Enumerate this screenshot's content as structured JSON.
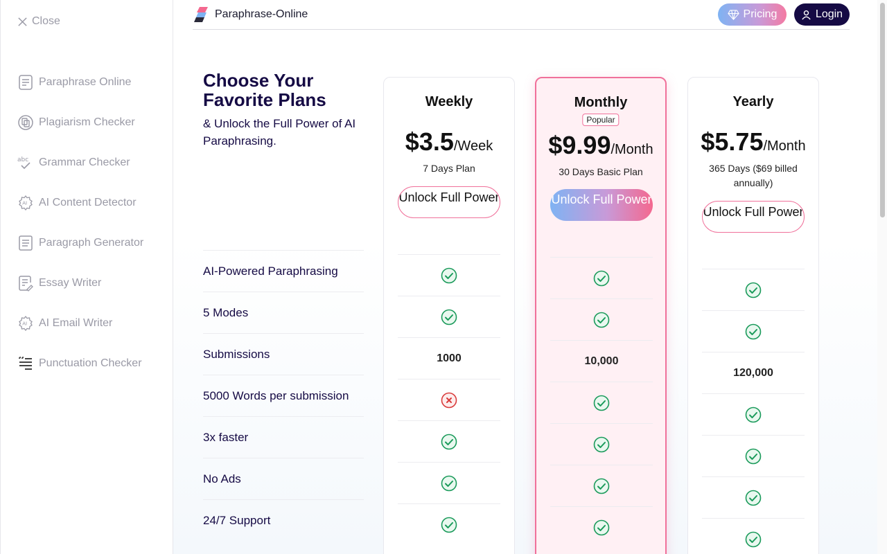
{
  "sidebar": {
    "close_label": "Close",
    "items": [
      {
        "label": "Paraphrase Online",
        "icon": "document-icon"
      },
      {
        "label": "Plagiarism Checker",
        "icon": "copy-circle-icon"
      },
      {
        "label": "Grammar Checker",
        "icon": "abc-check-icon"
      },
      {
        "label": "AI Content Detector",
        "icon": "ai-gear-icon"
      },
      {
        "label": "Paragraph Generator",
        "icon": "paragraph-icon"
      },
      {
        "label": "Essay Writer",
        "icon": "essay-pen-icon"
      },
      {
        "label": "AI Email Writer",
        "icon": "ai-gear-icon"
      },
      {
        "label": "Punctuation Checker",
        "icon": "punctuation-icon"
      }
    ]
  },
  "header": {
    "brand": "Paraphrase-Online",
    "pricing_label": "Pricing",
    "login_label": "Login"
  },
  "intro": {
    "title": "Choose Your Favorite Plans",
    "subtitle": "& Unlock the Full Power of AI Paraphrasing."
  },
  "features": [
    "AI-Powered Paraphrasing",
    "5 Modes",
    "Submissions",
    "5000 Words per submission",
    "3x faster",
    "No Ads",
    "24/7 Support"
  ],
  "plans": [
    {
      "name": "Weekly",
      "price": "$3.5",
      "period": "/Week",
      "description": "7 Days Plan",
      "cta": "Unlock Full Power",
      "values": [
        "check",
        "check",
        "1000",
        "cross",
        "check",
        "check",
        "check"
      ]
    },
    {
      "name": "Monthly",
      "badge": "Popular",
      "price": "$9.99",
      "period": "/Month",
      "description": "30 Days Basic Plan",
      "cta": "Unlock Full Power",
      "values": [
        "check",
        "check",
        "10,000",
        "check",
        "check",
        "check",
        "check"
      ]
    },
    {
      "name": "Yearly",
      "price": "$5.75",
      "period": "/Month",
      "description": "365 Days ($69 billed annually)",
      "cta": "Unlock Full Power",
      "values": [
        "check",
        "check",
        "120,000",
        "check",
        "check",
        "check",
        "check"
      ]
    }
  ],
  "colors": {
    "accent_pink": "#f0709a",
    "navy": "#150a44",
    "check_green": "#1a9a5a",
    "cross_red": "#d93a3a"
  }
}
